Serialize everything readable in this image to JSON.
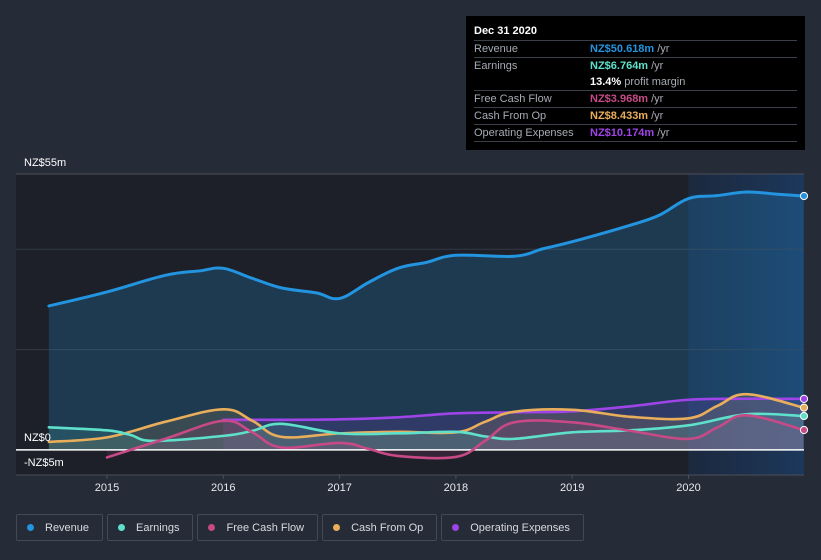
{
  "tooltip": {
    "date": "Dec 31 2020",
    "rows": [
      {
        "label": "Revenue",
        "value": "NZ$50.618m",
        "unit": "/yr",
        "color": "#2394df"
      },
      {
        "label": "Earnings",
        "value": "NZ$6.764m",
        "unit": "/yr",
        "color": "#5ee0cb"
      },
      {
        "label": "",
        "value": "13.4%",
        "unit": "profit margin",
        "color": "#ffffff"
      },
      {
        "label": "Free Cash Flow",
        "value": "NZ$3.968m",
        "unit": "/yr",
        "color": "#c74a87"
      },
      {
        "label": "Cash From Op",
        "value": "NZ$8.433m",
        "unit": "/yr",
        "color": "#e9ae5b"
      },
      {
        "label": "Operating Expenses",
        "value": "NZ$10.174m",
        "unit": "/yr",
        "color": "#9f44e8"
      }
    ]
  },
  "legend": [
    {
      "label": "Revenue",
      "color": "#2394df"
    },
    {
      "label": "Earnings",
      "color": "#5ee0cb"
    },
    {
      "label": "Free Cash Flow",
      "color": "#c74a87"
    },
    {
      "label": "Cash From Op",
      "color": "#e9ae5b"
    },
    {
      "label": "Operating Expenses",
      "color": "#9f44e8"
    }
  ],
  "chart_data": {
    "type": "area",
    "title": "",
    "xlabel": "",
    "ylabel": "",
    "y_top_label": "NZ$55m",
    "y_zero_label": "NZ$0",
    "y_bottom_label": "-NZ$5m",
    "ylim": [
      -5,
      55
    ],
    "xlim": [
      2014.5,
      2021.0
    ],
    "x_ticks": [
      2015,
      2016,
      2017,
      2018,
      2019,
      2020
    ],
    "x_tick_labels": [
      "2015",
      "2016",
      "2017",
      "2018",
      "2019",
      "2020"
    ],
    "grid": true,
    "gridlines": [
      20,
      40,
      55
    ],
    "highlight_from": 2020.0,
    "legend_position": "bottom",
    "series": [
      {
        "name": "Revenue",
        "color": "#2394df",
        "x": [
          2014.5,
          2015.0,
          2015.5,
          2015.8,
          2016.0,
          2016.25,
          2016.5,
          2016.8,
          2017.0,
          2017.25,
          2017.5,
          2017.75,
          2018.0,
          2018.5,
          2018.75,
          2019.0,
          2019.5,
          2019.75,
          2020.0,
          2020.25,
          2020.5,
          2020.75,
          2020.99
        ],
        "y": [
          28.7,
          31.5,
          34.8,
          35.7,
          36.2,
          34.2,
          32.3,
          31.3,
          30.2,
          33.4,
          36.2,
          37.4,
          38.8,
          38.6,
          40.1,
          41.5,
          44.8,
          46.8,
          50.1,
          50.7,
          51.4,
          51.0,
          50.618
        ]
      },
      {
        "name": "Earnings",
        "color": "#5ee0cb",
        "x": [
          2014.5,
          2015.0,
          2015.2,
          2015.4,
          2016.0,
          2016.25,
          2016.5,
          2017.0,
          2017.5,
          2018.0,
          2018.25,
          2018.5,
          2019.0,
          2019.5,
          2020.0,
          2020.5,
          2020.99
        ],
        "y": [
          4.5,
          3.9,
          3.0,
          1.8,
          2.8,
          3.8,
          5.2,
          3.3,
          3.3,
          3.6,
          2.7,
          2.2,
          3.5,
          3.9,
          4.9,
          7.1,
          6.764
        ]
      },
      {
        "name": "Free Cash Flow",
        "color": "#c74a87",
        "x": [
          2015.0,
          2015.5,
          2016.0,
          2016.25,
          2016.5,
          2017.0,
          2017.25,
          2017.5,
          2018.0,
          2018.25,
          2018.5,
          2019.0,
          2019.5,
          2020.0,
          2020.25,
          2020.5,
          2020.99
        ],
        "y": [
          -1.5,
          2.2,
          5.8,
          3.5,
          0.5,
          1.4,
          0.2,
          -1.2,
          -1.4,
          1.8,
          5.5,
          5.5,
          3.8,
          2.2,
          4.5,
          6.9,
          3.968
        ]
      },
      {
        "name": "Cash From Op",
        "color": "#e9ae5b",
        "x": [
          2014.5,
          2015.0,
          2015.5,
          2016.0,
          2016.25,
          2016.5,
          2017.0,
          2017.5,
          2018.0,
          2018.25,
          2018.5,
          2019.0,
          2019.5,
          2020.0,
          2020.25,
          2020.5,
          2020.99
        ],
        "y": [
          1.6,
          2.5,
          5.6,
          8.1,
          5.8,
          2.6,
          3.3,
          3.6,
          3.5,
          5.6,
          7.6,
          8.0,
          6.6,
          6.3,
          8.8,
          11.1,
          8.433
        ]
      },
      {
        "name": "Operating Expenses",
        "color": "#9f44e8",
        "x": [
          2016.0,
          2016.5,
          2017.0,
          2017.5,
          2018.0,
          2018.5,
          2019.0,
          2019.5,
          2020.0,
          2020.5,
          2020.99
        ],
        "y": [
          6.0,
          6.0,
          6.1,
          6.5,
          7.3,
          7.5,
          7.7,
          8.7,
          10.0,
          10.2,
          10.174
        ]
      }
    ]
  }
}
